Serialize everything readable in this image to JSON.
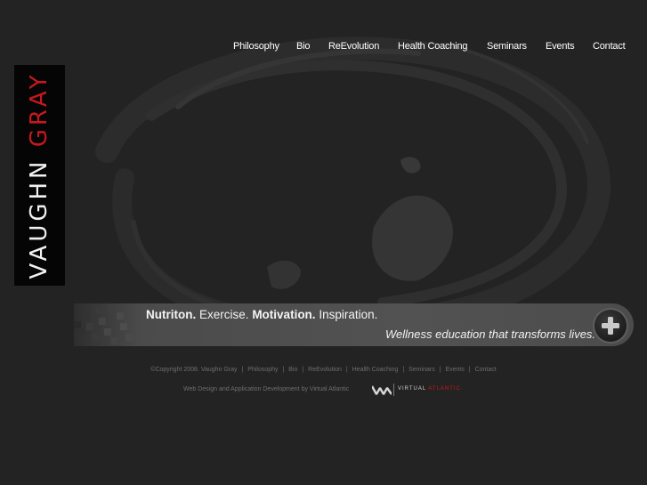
{
  "logo": {
    "first": "VAUGHN",
    "second": "GRAY"
  },
  "nav": {
    "items": [
      {
        "label": "Philosophy",
        "name": "nav-philosophy"
      },
      {
        "label": "Bio",
        "name": "nav-bio"
      },
      {
        "label": "ReEvolution",
        "name": "nav-reevolution"
      },
      {
        "label": "Health Coaching",
        "name": "nav-health-coaching"
      },
      {
        "label": "Seminars",
        "name": "nav-seminars"
      },
      {
        "label": "Events",
        "name": "nav-events"
      },
      {
        "label": "Contact",
        "name": "nav-contact"
      }
    ]
  },
  "banner": {
    "w1": "Nutriton.",
    "w2": "Exercise.",
    "w3": "Motivation.",
    "w4": "Inspiration.",
    "subtitle": "Wellness education that transforms lives.",
    "button_icon": "plus-icon"
  },
  "footer": {
    "copyright": "©Copyright 2008. Vaughn Gray",
    "links": [
      "Philosophy",
      "Bio",
      "ReEvolution",
      "Health Coaching",
      "Seminars",
      "Events",
      "Contact"
    ],
    "separator": "|",
    "credit": "Web Design and Application Development by Virtual Atlantic",
    "va_word1": "VIRTUAL",
    "va_word2": "ATLANTIC"
  },
  "colors": {
    "background": "#232323",
    "accent": "#c7181e",
    "banner": "#4f4f4f"
  }
}
